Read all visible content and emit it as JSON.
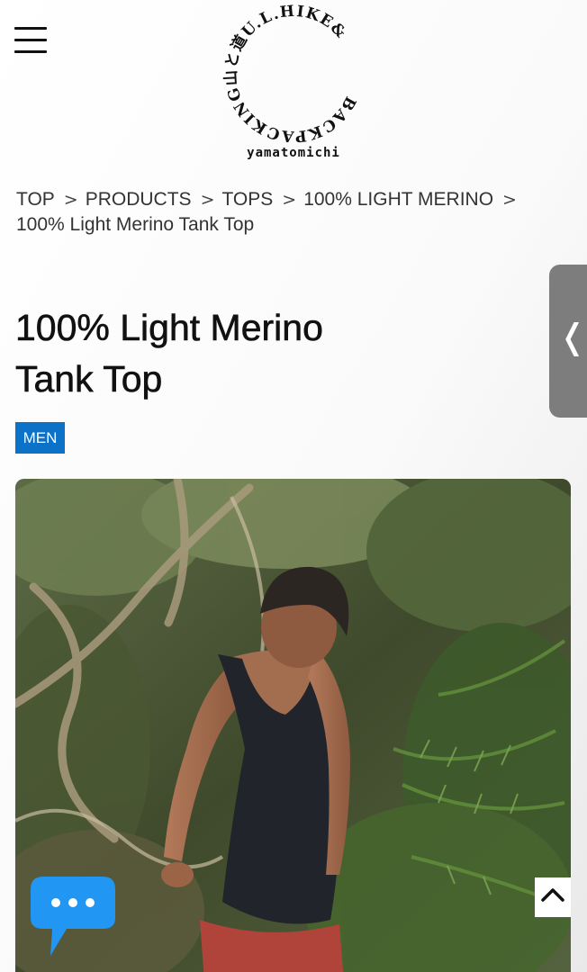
{
  "header": {
    "menu_icon": "hamburger-icon",
    "logo": {
      "ring_text": "BACKPACKING山と道U.L.HIKE&",
      "wordmark": "yamatomichi"
    }
  },
  "breadcrumb": {
    "items": [
      "TOP",
      "PRODUCTS",
      "TOPS",
      "100% LIGHT MERINO"
    ],
    "current": "100% Light Merino Tank Top",
    "separator": ">"
  },
  "product": {
    "title_line1": "100% Light Merino",
    "title_line2": "Tank Top",
    "badge": "MEN",
    "badge_color": "#0b72c8"
  },
  "side_tab": {
    "icon": "chevron-left-icon"
  },
  "hero": {
    "icon": "product-photo"
  },
  "chat": {
    "icon": "chat-bubble-icon",
    "color": "#2196f3"
  },
  "scroll_top": {
    "icon": "chevron-up-icon"
  }
}
